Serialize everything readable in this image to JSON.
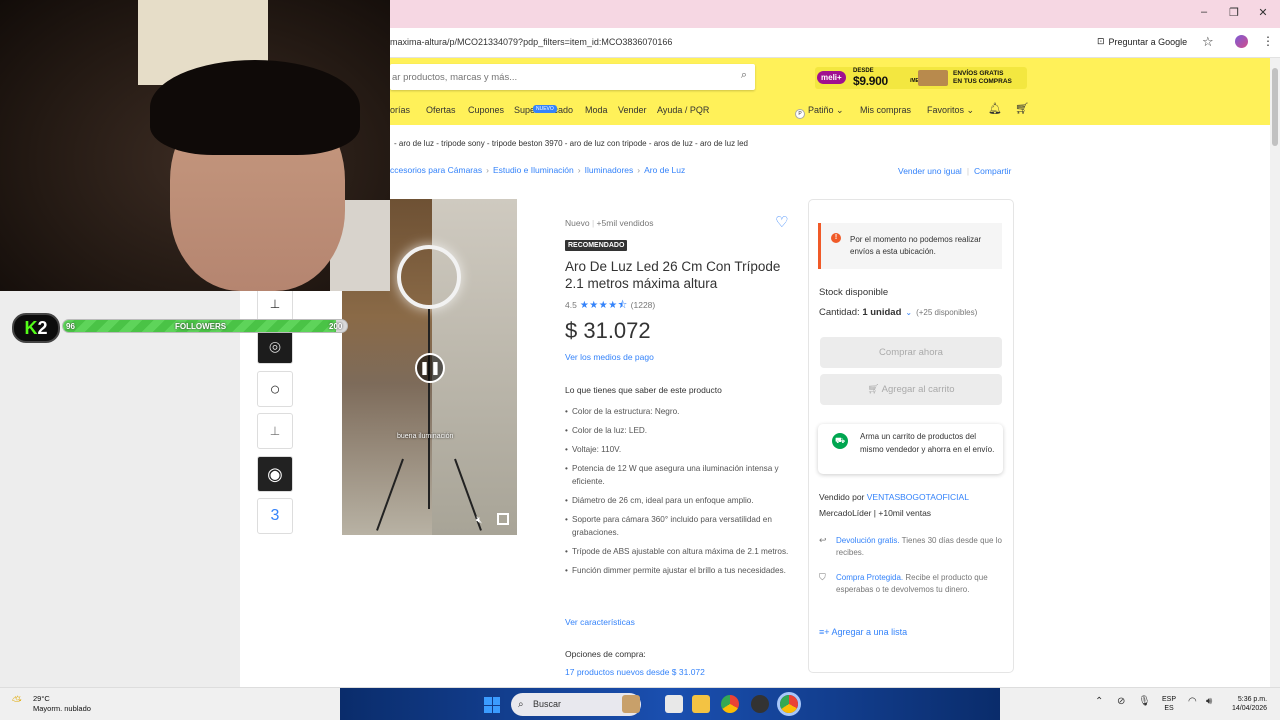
{
  "browser": {
    "url": "maxima-altura/p/MCO21334079?pdp_filters=item_id:MCO3836070166",
    "ask_google": "Preguntar a Google",
    "minimize": "–",
    "restore": "❐",
    "close": "✕"
  },
  "header": {
    "search_placeholder": "ar productos, marcas y más...",
    "promo": {
      "meli": "meli+",
      "desde": "DESDE",
      "price": "$9.900",
      "per": "/MES",
      "envios_line1": "ENVÍOS GRATIS",
      "envios_line2": "EN TUS COMPRAS"
    },
    "nav": [
      "orías",
      "Ofertas",
      "Cupones",
      "Supermercado",
      "Moda",
      "Vender",
      "Ayuda / PQR"
    ],
    "nuevo_badge": "NUEVO",
    "user": "Patiño",
    "user_initial": "P",
    "mis_compras": "Mis compras",
    "favoritos": "Favoritos"
  },
  "related_searches": "- aro de luz - tripode sony - tripode beston 3970 - aro de luz con tripode - aros de luz - aro de luz led",
  "breadcrumb": [
    "ccesorios para Cámaras",
    "Estudio e Iluminación",
    "Iluminadores",
    "Aro de Luz"
  ],
  "breadcrumb_sep": "›",
  "top_links": [
    "Vender uno igual",
    "Compartir"
  ],
  "gallery": {
    "video_caption": "buena iluminación",
    "thumb_last": "3"
  },
  "stream_overlay": {
    "logo_k": "K",
    "logo_2": "2",
    "progress": 0.96,
    "current": "96",
    "label": "FOLLOWERS",
    "goal": "200"
  },
  "product": {
    "condition": "Nuevo",
    "sold": "+5mil vendidos",
    "badge": "RECOMENDADO",
    "title": "Aro De Luz Led 26 Cm Con Trípode 2.1 metros máxima altura",
    "rating": "4.5",
    "stars": "★★★★⯪",
    "reviews": "(1228)",
    "price": "$ 31.072",
    "payment_link": "Ver los medios de pago",
    "know_title": "Lo que tienes que saber de este producto",
    "features": [
      "Color de la estructura: Negro.",
      "Color de la luz: LED.",
      "Voltaje: 110V.",
      "Potencia de 12 W que asegura una iluminación intensa y eficiente.",
      "Diámetro de 26 cm, ideal para un enfoque amplio.",
      "Soporte para cámara 360° incluido para versatilidad en grabaciones.",
      "Trípode de ABS ajustable con altura máxima de 2.1 metros.",
      "Función dimmer permite ajustar el brillo a tus necesidades."
    ],
    "see_features": "Ver características",
    "options_title": "Opciones de compra:",
    "options_link": "17 productos nuevos desde $ 31.072"
  },
  "buybox": {
    "alert": "Por el momento no podemos realizar envíos a esta ubicación.",
    "stock": "Stock disponible",
    "qty_label": "Cantidad:",
    "qty_value": "1 unidad",
    "qty_available": "(+25 disponibles)",
    "buy_now": "Comprar ahora",
    "add_cart": "Agregar al carrito",
    "cart_tip": "Arma un carrito de productos del mismo vendedor y ahorra en el envío.",
    "sold_by": "Vendido por",
    "seller_name": "VENTASBOGOTAOFICIAL",
    "lider": "MercadoLíder | +10mil ventas",
    "return_link": "Devolución gratis.",
    "return_text": " Tienes 30 días desde que lo recibes.",
    "protect_link": "Compra Protegida.",
    "protect_text": " Recibe el producto que esperabas o te devolvemos tu dinero.",
    "add_list": "Agregar a una lista"
  },
  "taskbar": {
    "temp": "29°C",
    "weather": "Mayorm. nublado",
    "search": "Buscar",
    "lang_top": "ESP",
    "lang_bottom": "ES",
    "time": "5:36 p.m.",
    "date": "14/04/2026"
  }
}
